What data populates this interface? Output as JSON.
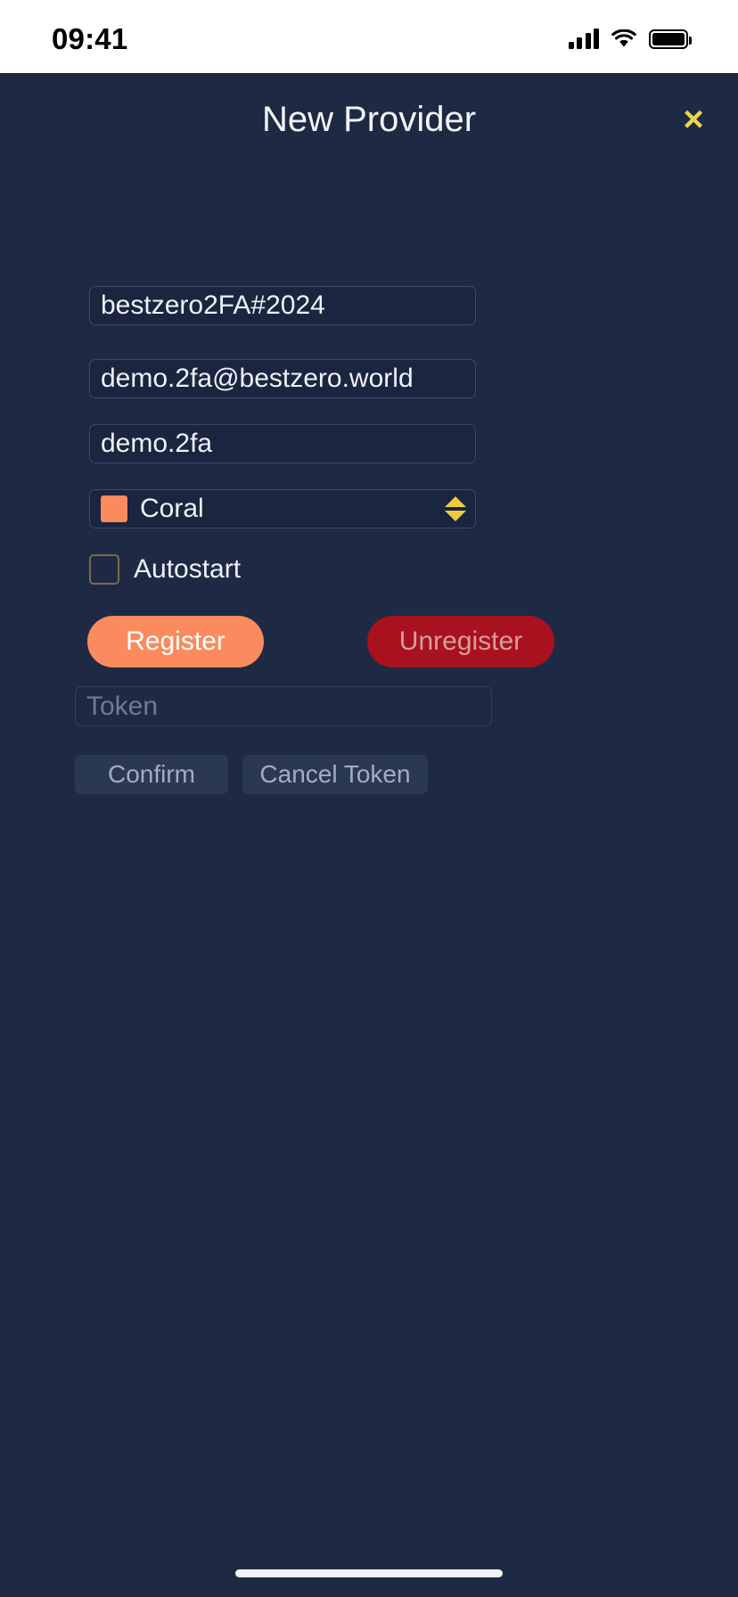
{
  "status_bar": {
    "time": "09:41",
    "signal_icon": "cellular-bars-icon",
    "wifi_icon": "wifi-icon",
    "battery_icon": "battery-icon"
  },
  "header": {
    "title": "New Provider",
    "close_label": "×",
    "close_icon": "close-icon",
    "close_color": "#e8d84a"
  },
  "form": {
    "name_field": {
      "value": "bestzero2FA#2024",
      "placeholder": ""
    },
    "email_field": {
      "value": "demo.2fa@bestzero.world",
      "placeholder": ""
    },
    "username_field": {
      "value": "demo.2fa",
      "placeholder": ""
    },
    "color_select": {
      "value": "Coral",
      "swatch_color": "#fb8b5e",
      "stepper_icon": "stepper-up-down-icon",
      "stepper_color": "#f0c93f"
    },
    "autostart": {
      "label": "Autostart",
      "checked": false
    },
    "register_button": {
      "label": "Register",
      "color": "#fb8b5e"
    },
    "unregister_button": {
      "label": "Unregister",
      "color": "#a8121f"
    },
    "token_field": {
      "value": "",
      "placeholder": "Token"
    },
    "confirm_button": {
      "label": "Confirm"
    },
    "cancel_token_button": {
      "label": "Cancel Token"
    }
  },
  "theme": {
    "background": "#1e2a44",
    "field_background": "#1a2540",
    "field_border": "#3b4a68",
    "text": "#eef1f6",
    "muted_text": "#6f7b94"
  }
}
